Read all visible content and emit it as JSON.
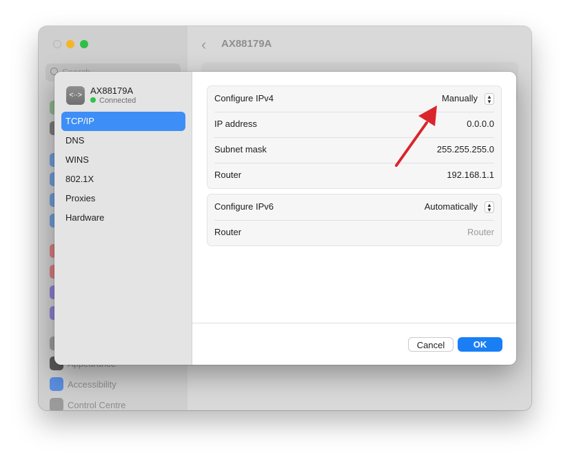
{
  "background_window": {
    "search_placeholder": "Search",
    "title": "AX88179A",
    "sidebar_items": [
      "Appearance",
      "Accessibility",
      "Control Centre"
    ]
  },
  "dialog": {
    "service": {
      "name": "AX88179A",
      "status": "Connected",
      "icon": "network-interface-icon",
      "status_color": "#32c24d"
    },
    "nav": [
      "TCP/IP",
      "DNS",
      "WINS",
      "802.1X",
      "Proxies",
      "Hardware"
    ],
    "ipv4": {
      "configure_label": "Configure IPv4",
      "configure_value": "Manually",
      "ip_label": "IP address",
      "ip_value": "0.0.0.0",
      "subnet_label": "Subnet mask",
      "subnet_value": "255.255.255.0",
      "router_label": "Router",
      "router_value": "192.168.1.1"
    },
    "ipv6": {
      "configure_label": "Configure IPv6",
      "configure_value": "Automatically",
      "router_label": "Router",
      "router_placeholder": "Router"
    },
    "buttons": {
      "cancel": "Cancel",
      "ok": "OK"
    },
    "accent_color": "#1a7ff5"
  },
  "annotation": {
    "arrow_color": "#d9262c"
  }
}
